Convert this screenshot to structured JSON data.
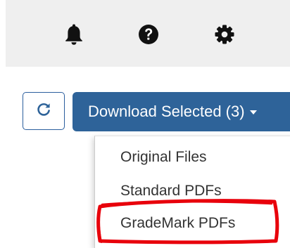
{
  "notifications": {
    "icon": "bell-icon"
  },
  "help": {
    "icon": "question-circle-icon"
  },
  "settings": {
    "icon": "gear-icon"
  },
  "refresh": {
    "icon": "refresh-icon"
  },
  "download": {
    "label": "Download Selected (3)",
    "caret_icon": "caret-down-icon"
  },
  "menu": {
    "items": [
      {
        "label": "Original Files"
      },
      {
        "label": "Standard PDFs"
      },
      {
        "label": "GradeMark PDFs"
      }
    ],
    "highlighted_item": "GradeMark PDFs"
  },
  "colors": {
    "topbar_bg": "#efefef",
    "primary": "#2e6399",
    "highlight": "#e8000b",
    "icon": "#111111"
  }
}
